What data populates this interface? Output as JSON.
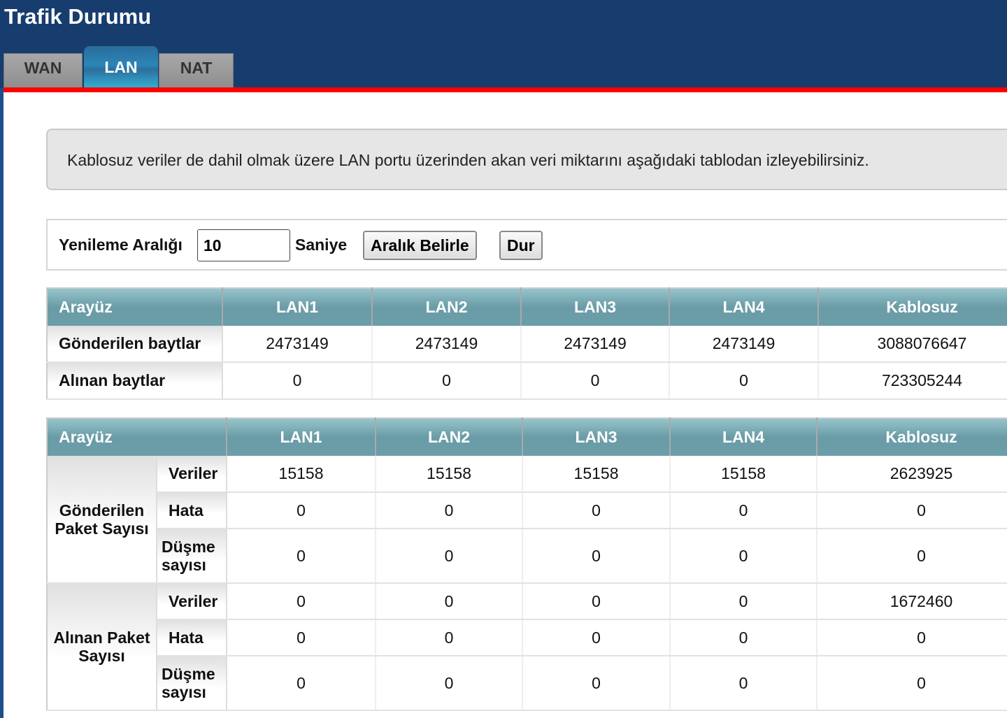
{
  "title": "Trafik Durumu",
  "tabs": [
    "WAN",
    "LAN",
    "NAT"
  ],
  "info": "Kablosuz veriler de dahil olmak üzere LAN portu üzerinden akan veri miktarını aşağıdaki tablodan izleyebilirsiniz.",
  "controls": {
    "interval_label": "Yenileme Aralığı",
    "interval_value": "10",
    "unit": "Saniye",
    "set_button": "Aralık Belirle",
    "stop_button": "Dur"
  },
  "table1": {
    "headers": [
      "Arayüz",
      "LAN1",
      "LAN2",
      "LAN3",
      "LAN4",
      "Kablosuz"
    ],
    "rows": [
      {
        "label": "Gönderilen baytlar",
        "values": [
          "2473149",
          "2473149",
          "2473149",
          "2473149",
          "3088076647"
        ]
      },
      {
        "label": "Alınan baytlar",
        "values": [
          "0",
          "0",
          "0",
          "0",
          "723305244"
        ]
      }
    ]
  },
  "table2": {
    "headers": [
      "Arayüz",
      "LAN1",
      "LAN2",
      "LAN3",
      "LAN4",
      "Kablosuz"
    ],
    "groups": [
      {
        "label": "Gönderilen Paket Sayısı",
        "rows": [
          {
            "label": "Veriler",
            "values": [
              "15158",
              "15158",
              "15158",
              "15158",
              "2623925"
            ]
          },
          {
            "label": "Hata",
            "values": [
              "0",
              "0",
              "0",
              "0",
              "0"
            ]
          },
          {
            "label": "Düşme sayısı",
            "values": [
              "0",
              "0",
              "0",
              "0",
              "0"
            ]
          }
        ]
      },
      {
        "label": "Alınan Paket Sayısı",
        "rows": [
          {
            "label": "Veriler",
            "values": [
              "0",
              "0",
              "0",
              "0",
              "1672460"
            ]
          },
          {
            "label": "Hata",
            "values": [
              "0",
              "0",
              "0",
              "0",
              "0"
            ]
          },
          {
            "label": "Düşme sayısı",
            "values": [
              "0",
              "0",
              "0",
              "0",
              "0"
            ]
          }
        ]
      }
    ]
  }
}
